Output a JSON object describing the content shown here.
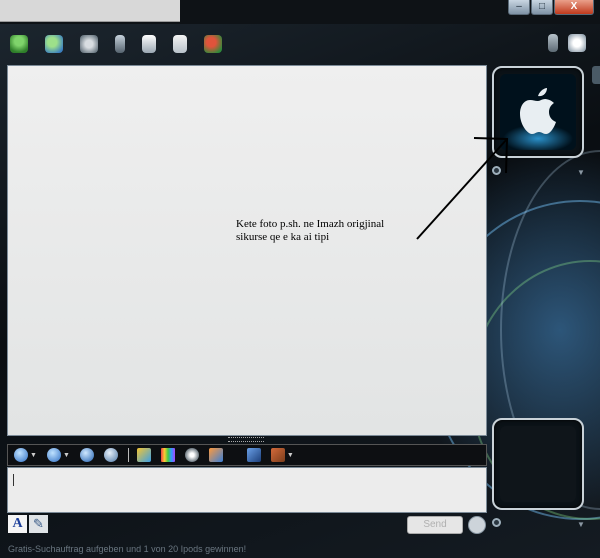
{
  "window": {
    "controls": {
      "minimize": "–",
      "maximize": "□",
      "close": "X"
    }
  },
  "toolbar": {
    "icons": [
      "contacts-icon",
      "add-contact-icon",
      "webcam-icon",
      "mobile-phone-icon",
      "send-file-icon",
      "games-icon",
      "activities-icon"
    ],
    "right_icons": [
      "person-icon",
      "menu-icon"
    ]
  },
  "annotation": {
    "note_line1": "Kete foto p.sh. ne Imazh origjinal",
    "note_line2": "sikurse qe e ka ai tipi"
  },
  "format_bar": {
    "items": [
      "emoticon-icon",
      "wink-icon",
      "nudge-icon",
      "voice-clip-icon",
      "wink-animation-icon",
      "background-icon",
      "sound-icon",
      "games-small-icon",
      "translate-icon",
      "gift-icon"
    ]
  },
  "compose": {
    "font_label": "A",
    "handwrite_label": "✎",
    "send_label": "Send"
  },
  "status": {
    "text": "Gratis-Suchauftrag aufgeben und 1 von 20 Ipods gewinnen!"
  },
  "colors": {
    "conversation_bg": "#e6e7e7",
    "panel_border": "#7b8a97",
    "accent_blue": "#2a8fc8"
  }
}
